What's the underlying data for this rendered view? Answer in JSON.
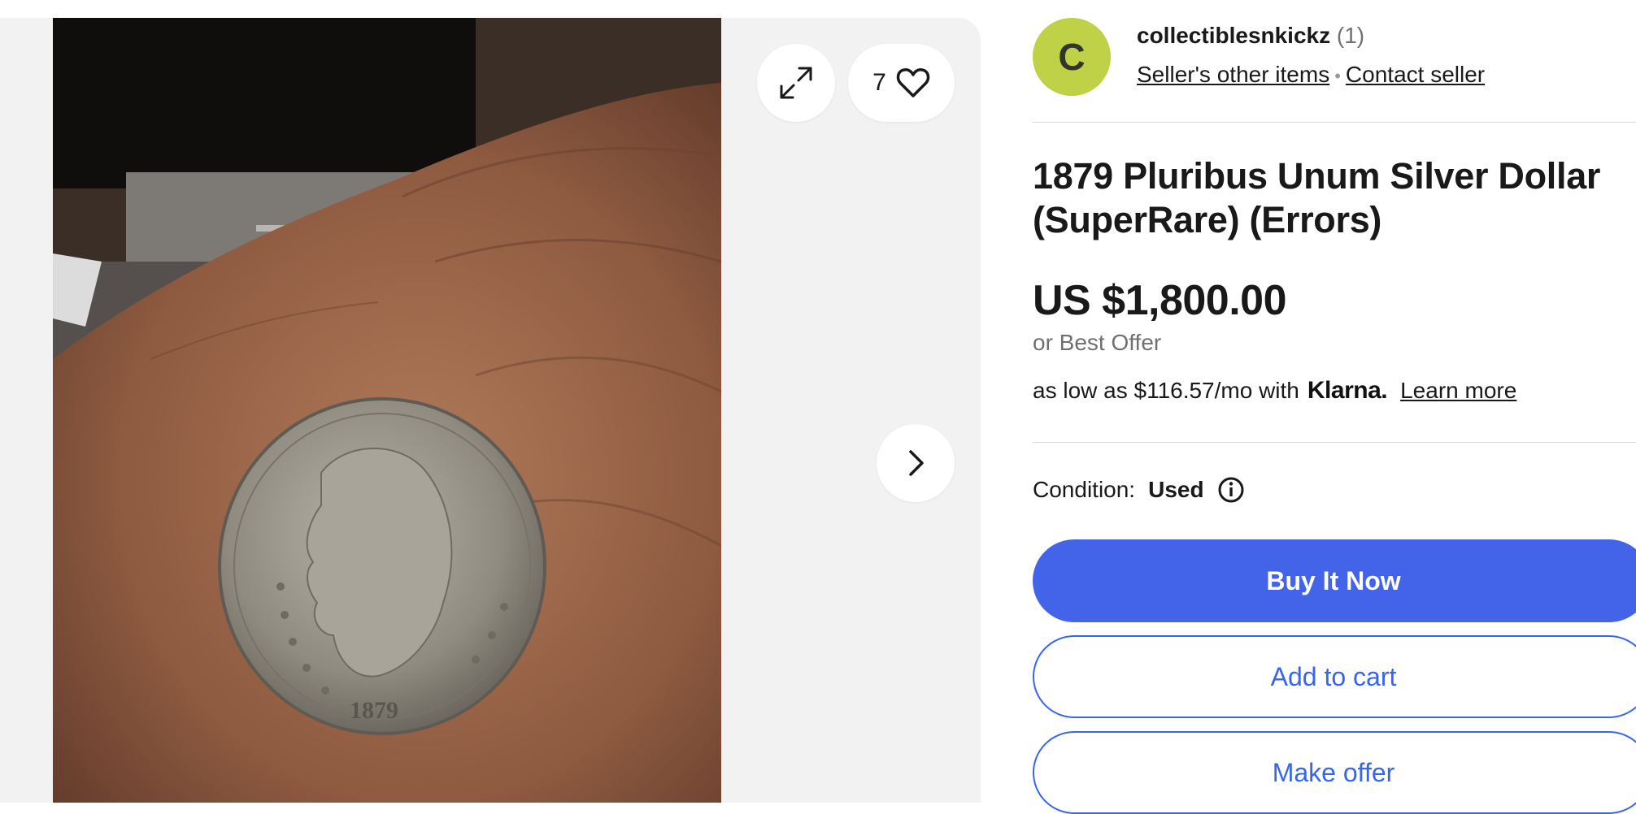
{
  "gallery": {
    "watch_count": "7",
    "icons": {
      "expand": "expand-icon",
      "watch": "heart-icon",
      "next": "chevron-right-icon"
    }
  },
  "seller": {
    "avatar_letter": "C",
    "name": "collectiblesnkickz",
    "feedback": "(1)",
    "other_items": "Seller's other items",
    "contact": "Contact seller"
  },
  "listing": {
    "title": "1879 Pluribus Unum Silver Dollar (SuperRare) (Errors)",
    "price": "US $1,800.00",
    "best_offer": "or Best Offer",
    "financing": "as low as $116.57/mo with",
    "financing_brand": "Klarna.",
    "learn_more": "Learn more",
    "condition_label": "Condition:",
    "condition_value": "Used"
  },
  "actions": {
    "buy_now": "Buy It Now",
    "add_to_cart": "Add to cart",
    "make_offer": "Make offer"
  },
  "colors": {
    "primary": "#4364e8",
    "link_blue": "#3665f3",
    "avatar": "#bfd146"
  }
}
